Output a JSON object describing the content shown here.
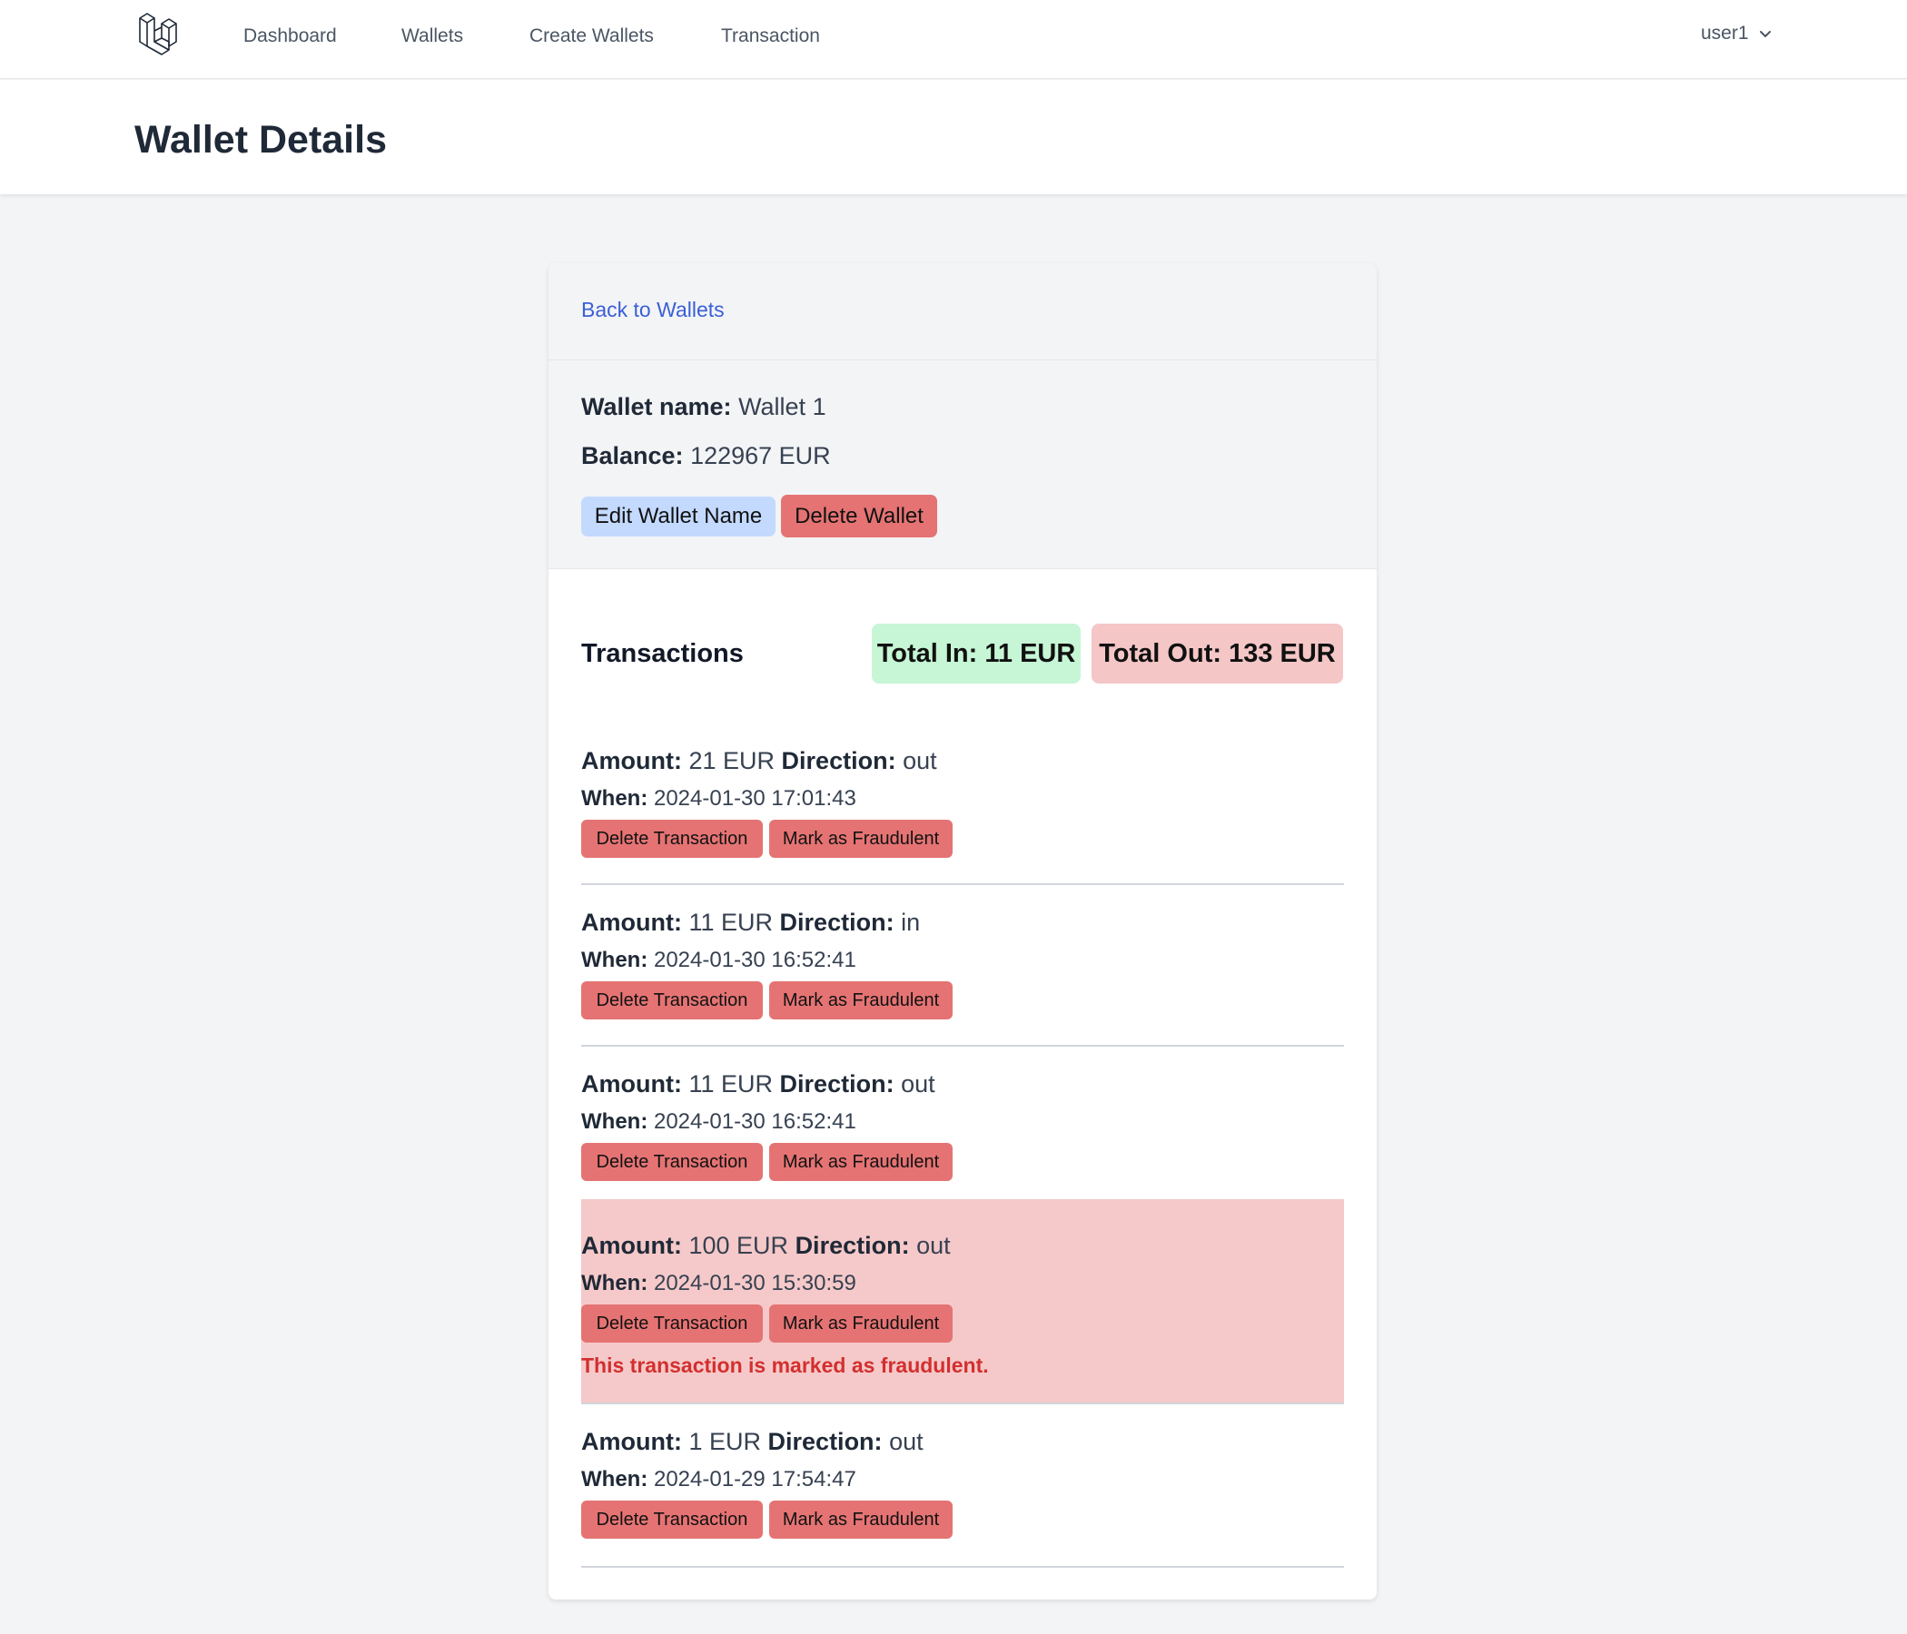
{
  "nav": {
    "links": [
      "Dashboard",
      "Wallets",
      "Create Wallets",
      "Transaction"
    ],
    "user": "user1"
  },
  "header": {
    "title": "Wallet Details"
  },
  "wallet": {
    "back_link": "Back to Wallets",
    "name_label": "Wallet name:",
    "name": "Wallet 1",
    "balance_label": "Balance:",
    "balance": "122967 EUR",
    "edit_button": "Edit Wallet Name",
    "delete_button": "Delete Wallet"
  },
  "transactions": {
    "title": "Transactions",
    "total_in": "Total In: 11 EUR",
    "total_out": "Total Out: 133 EUR",
    "amount_label": "Amount:",
    "direction_label": "Direction:",
    "when_label": "When:",
    "delete_label": "Delete Transaction",
    "fraud_label": "Mark as Fraudulent",
    "fraud_message": "This transaction is marked as fraudulent.",
    "items": [
      {
        "amount": "21 EUR",
        "direction": "out",
        "when": "2024-01-30 17:01:43",
        "fraudulent": false
      },
      {
        "amount": "11 EUR",
        "direction": "in",
        "when": "2024-01-30 16:52:41",
        "fraudulent": false
      },
      {
        "amount": "11 EUR",
        "direction": "out",
        "when": "2024-01-30 16:52:41",
        "fraudulent": false
      },
      {
        "amount": "100 EUR",
        "direction": "out",
        "when": "2024-01-30 15:30:59",
        "fraudulent": true
      },
      {
        "amount": "1 EUR",
        "direction": "out",
        "when": "2024-01-29 17:54:47",
        "fraudulent": false
      }
    ]
  },
  "colors": {
    "fraud_row": "#f5c9c9",
    "danger_button": "#e57373",
    "edit_button": "#c3dafe",
    "total_in_bg": "#c6f6d5",
    "total_out_bg": "#f5c6c6",
    "link": "#3b5fd6",
    "fraud_text": "#d32f2f"
  }
}
